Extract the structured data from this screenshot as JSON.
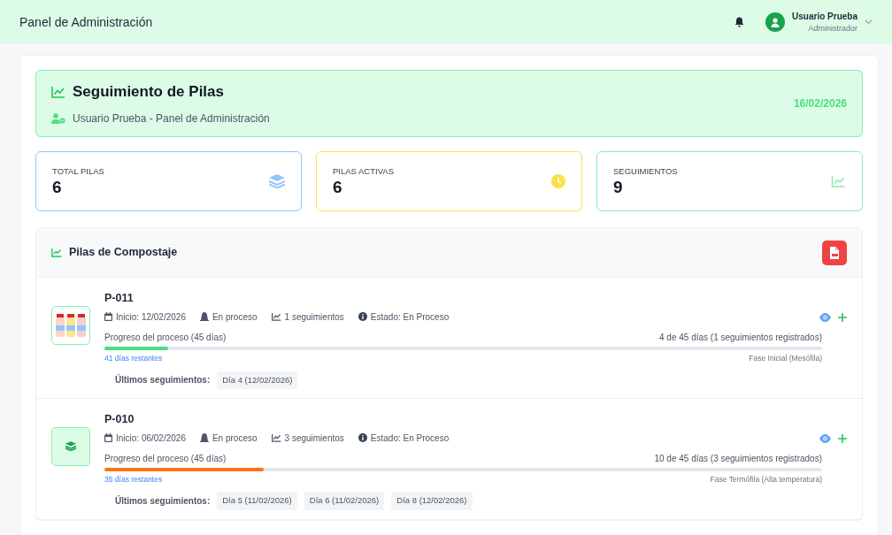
{
  "navbar": {
    "title": "Panel de Administración",
    "user": {
      "name": "Usuario Prueba",
      "role": "Administrador"
    }
  },
  "banner": {
    "title": "Seguimiento de Pilas",
    "subtitle": "Usuario Prueba - Panel de Administración",
    "date": "16/02/2026"
  },
  "stats": [
    {
      "label": "TOTAL PILAS",
      "value": "6",
      "kind": "layers",
      "color": "#93c5fd"
    },
    {
      "label": "PILAS ACTIVAS",
      "value": "6",
      "kind": "clock",
      "color": "#fde047"
    },
    {
      "label": "SEGUIMIENTOS",
      "value": "9",
      "kind": "chart",
      "color": "#86efac"
    }
  ],
  "section": {
    "title": "Pilas de Compostaje",
    "piles": [
      {
        "code": "P-011",
        "kind": "photo",
        "start": "Inicio: 12/02/2026",
        "process": "En proceso",
        "count": "1 seguimientos",
        "status": "Estado: En Proceso",
        "progress_label": "Progreso del proceso (45 días)",
        "progress_reading": "4 de 45 días (1 seguimientos registrados)",
        "level": 0.089,
        "color": "#4ade80",
        "remaining": "41 días restantes",
        "phase": "Fase Inicial (Mesófila)",
        "recent_label": "Últimos seguimientos:",
        "recent": [
          "Día 4 (12/02/2026)"
        ]
      },
      {
        "code": "P-010",
        "kind": "icon",
        "start": "Inicio: 06/02/2026",
        "process": "En proceso",
        "count": "3 seguimientos",
        "status": "Estado: En Proceso",
        "progress_label": "Progreso del proceso (45 días)",
        "progress_reading": "10 de 45 días (3 seguimientos registrados)",
        "level": 0.222,
        "color": "#f97316",
        "remaining": "35 días restantes",
        "phase": "Fase Termófila (Alta temperatura)",
        "recent_label": "Últimos seguimientos:",
        "recent": [
          "Día 5 (11/02/2026)",
          "Día 6 (11/02/2026)",
          "Día 8 (12/02/2026)"
        ]
      }
    ]
  }
}
